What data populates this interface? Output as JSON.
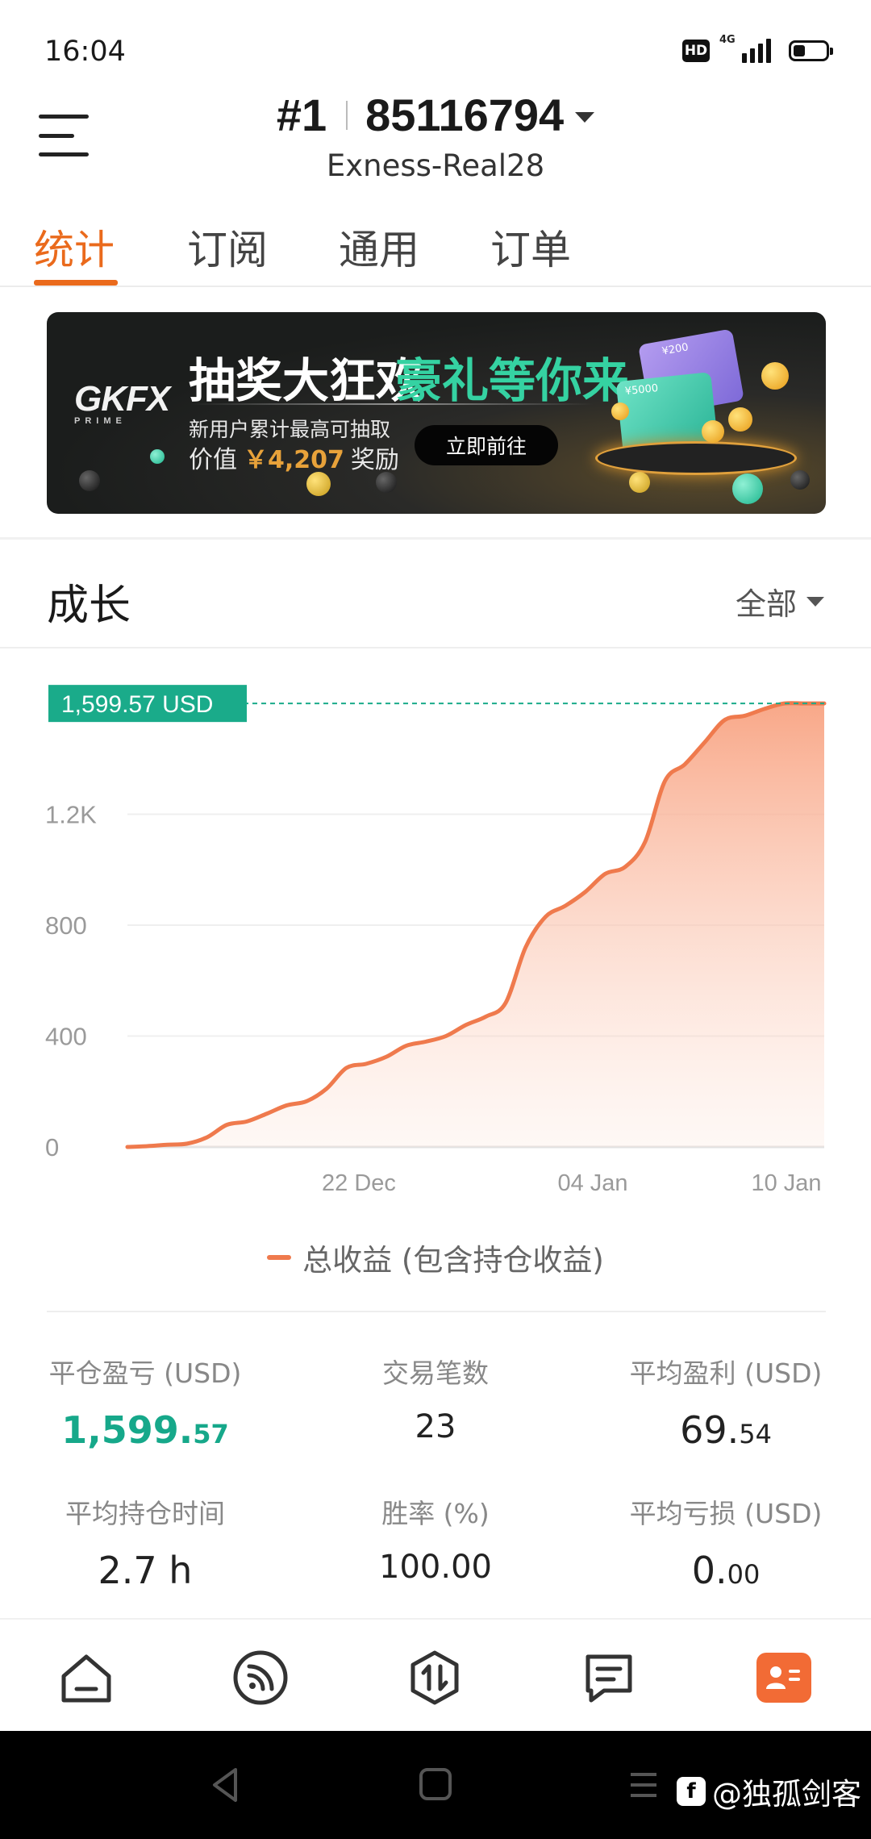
{
  "status_bar": {
    "time": "16:04",
    "hd_label": "HD",
    "network_label": "4G"
  },
  "header": {
    "account_prefix": "#1",
    "account_number": "85116794",
    "server": "Exness-Real28"
  },
  "tabs": [
    {
      "label": "统计",
      "active": true
    },
    {
      "label": "订阅",
      "active": false
    },
    {
      "label": "通用",
      "active": false
    },
    {
      "label": "订单",
      "active": false
    }
  ],
  "banner": {
    "brand": "GKFX",
    "brand_sub": "PRIME",
    "headline_white": "抽奖大狂欢",
    "headline_green": "豪礼等你来",
    "subtitle": "新用户累计最高可抽取",
    "value_prefix": "价值",
    "value_amount": "￥4,207",
    "value_suffix": "奖励",
    "cta_label": "立即前往",
    "card_small_label": "¥200",
    "card_large_label": "¥5000"
  },
  "growth": {
    "title": "成长",
    "filter_label": "全部"
  },
  "chart_data": {
    "type": "area",
    "current_value_label": "1,599.57 USD",
    "y_ticks": [
      "0",
      "400",
      "800",
      "1.2K"
    ],
    "y_tick_values": [
      0,
      400,
      800,
      1200
    ],
    "x_ticks": [
      "22 Dec",
      "04 Jan",
      "10 Jan"
    ],
    "ylim": [
      0,
      1600
    ],
    "series": [
      {
        "name": "总收益 (包含持仓收益)",
        "values": [
          0,
          3,
          8,
          12,
          35,
          80,
          92,
          120,
          150,
          165,
          210,
          285,
          300,
          325,
          365,
          380,
          400,
          440,
          470,
          520,
          720,
          830,
          870,
          920,
          985,
          1010,
          1100,
          1320,
          1380,
          1460,
          1540,
          1555,
          1580,
          1599.57,
          1599.57,
          1599.57
        ]
      }
    ],
    "accent_color": "#ef7a4d",
    "badge_color": "#1aab8a"
  },
  "legend": {
    "label": "总收益 (包含持仓收益)"
  },
  "stats": {
    "closed_pnl": {
      "label": "平仓盈亏 (USD)",
      "int": "1,599.",
      "dec": "57"
    },
    "trade_count": {
      "label": "交易笔数",
      "value": "23"
    },
    "avg_profit": {
      "label": "平均盈利 (USD)",
      "int": "69.",
      "dec": "54"
    },
    "avg_hold_time": {
      "label": "平均持仓时间",
      "value": "2.7 h"
    },
    "win_rate": {
      "label": "胜率 (%)",
      "value": "100.00"
    },
    "avg_loss": {
      "label": "平均亏损 (USD)",
      "int": "0.",
      "dec": "00"
    }
  },
  "bottom_nav": [
    {
      "icon": "home-icon",
      "active": false
    },
    {
      "icon": "rss-icon",
      "active": false
    },
    {
      "icon": "trade-icon",
      "active": false
    },
    {
      "icon": "message-icon",
      "active": false
    },
    {
      "icon": "profile-card-icon",
      "active": true
    }
  ],
  "watermark": {
    "logo": "f",
    "text": "@独孤剑客"
  }
}
